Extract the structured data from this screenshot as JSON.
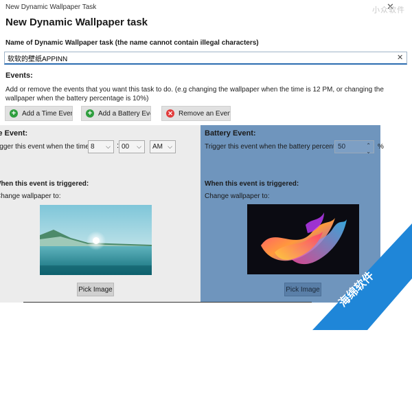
{
  "window": {
    "title": "New Dynamic Wallpaper Task",
    "close_glyph": "✕"
  },
  "watermark_top": "小众软件",
  "watermark_ribbon": "海绵软件",
  "heading": "New Dynamic Wallpaper task",
  "name_field": {
    "label": "Name of Dynamic Wallpaper task (the name cannot contain illegal characters)",
    "value": "软软的壁纸APPINN",
    "clear_glyph": "✕"
  },
  "events": {
    "label": "Events:",
    "description": "Add or remove the events that you want this task to do. (e.g changing the wallpaper when the time is 12 PM, or changing the wallpaper when the battery percentage is 10%)",
    "buttons": {
      "add_time": "Add a Time Event",
      "add_battery": "Add a Battery Event",
      "remove": "Remove an Event"
    }
  },
  "time_event": {
    "title": "Time Event:",
    "trigger_text": "Trigger this event when the time is",
    "hour": "8",
    "colon": ":",
    "minute": "00",
    "ampm": "AM",
    "when_triggered": "When this event is triggered:",
    "change_wallpaper": "Change wallpaper to:",
    "pick_image": "Pick Image"
  },
  "battery_event": {
    "title": "Battery Event:",
    "trigger_text": "Trigger this event when the battery percentage is",
    "percentage": "50",
    "percent_sign": "%",
    "when_triggered": "When this event is triggered:",
    "change_wallpaper": "Change wallpaper to:",
    "pick_image": "Pick Image"
  },
  "icons": {
    "add": "plus-icon",
    "remove": "x-circle-icon",
    "dropdown": "chevron-down-icon",
    "spinner": "spinner-arrows-icon"
  },
  "colors": {
    "accent": "#2b6cb0",
    "selected_panel": "#6f95bd",
    "unselected_panel": "#ececec",
    "ribbon": "#1f86d8"
  }
}
